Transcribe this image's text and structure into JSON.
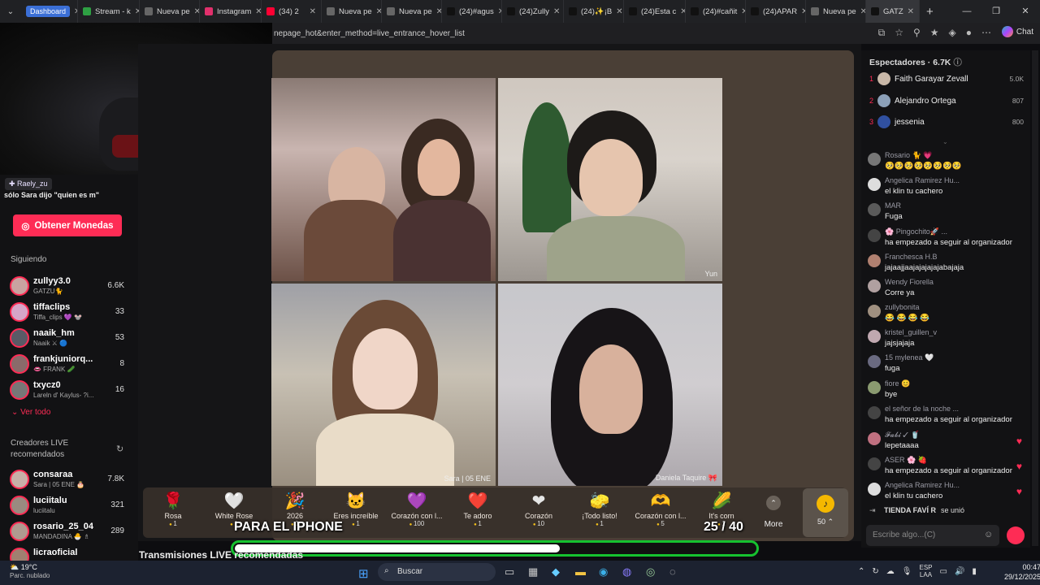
{
  "browser": {
    "tabs": [
      {
        "label": "Dashboard",
        "color": "#3b6fd6"
      },
      {
        "label": "Stream - k",
        "color": "#2ea043"
      },
      {
        "label": "Nueva pe",
        "color": "#666"
      },
      {
        "label": "Instagram",
        "color": "#e1306c"
      },
      {
        "label": "(34) 2",
        "color": "#ff0033"
      },
      {
        "label": "Nueva pe",
        "color": "#666"
      },
      {
        "label": "Nueva pe",
        "color": "#666"
      },
      {
        "label": "(24)#agus",
        "color": "#111"
      },
      {
        "label": "(24)Zully",
        "color": "#111"
      },
      {
        "label": "(24)✨¡B",
        "color": "#111"
      },
      {
        "label": "(24)Esta c",
        "color": "#111"
      },
      {
        "label": "(24)#cañit",
        "color": "#111"
      },
      {
        "label": "(24)APAR",
        "color": "#111"
      },
      {
        "label": "Nueva pe",
        "color": "#666"
      },
      {
        "label": "GATZ",
        "color": "#111"
      }
    ],
    "new_tab": "+",
    "address": "nepage_hot&enter_method=live_entrance_hover_list",
    "chat_label": "Chat"
  },
  "overlay": {
    "chat_user": "Raely_zu",
    "chat_message": "sólo Sara dijo \"quien es m\"",
    "iphone_text": "PARA EL IPHONE",
    "goal_count": "25 / 40",
    "goal_progress": 0.625
  },
  "sidebar": {
    "coins_button": "Obtener Monedas",
    "following_title": "Siguiendo",
    "following": [
      {
        "name": "zullyy3.0",
        "sub": "GATZU🐈",
        "count": "6.6K"
      },
      {
        "name": "tiffaclips",
        "sub": "Tiffa_clips 💜 🐭",
        "count": "33"
      },
      {
        "name": "naaik_hm",
        "sub": "Naaik ⚔ 🔵",
        "count": "53"
      },
      {
        "name": "frankjuniorq...",
        "sub": "👄 FRANK 🥒",
        "count": "8"
      },
      {
        "name": "txycz0",
        "sub": "Lareln d' Kaylus- ?i...",
        "count": "16"
      }
    ],
    "see_all": "Ver todo",
    "creators_title": "Creadores LIVE recomendados",
    "creators": [
      {
        "name": "consaraa",
        "sub": "Sara | 05 ENE 🎂",
        "count": "7.8K"
      },
      {
        "name": "luciitalu",
        "sub": "luciitalu",
        "count": "321"
      },
      {
        "name": "rosario_25_04",
        "sub": "MANDADINA 🐣 ♗",
        "count": "289"
      },
      {
        "name": "licraoficial",
        "sub": "",
        "count": ""
      }
    ]
  },
  "stage": {
    "tile_labels": [
      "",
      "Yun",
      "Sara | 05 ENE",
      "Daniela Taquire 🎀"
    ],
    "recommended_title": "Transmisiones LIVE recomendadas"
  },
  "gifts": [
    {
      "name": "Rosa",
      "price": "1",
      "icon": "🌹"
    },
    {
      "name": "White Rose",
      "price": "1",
      "icon": "🤍"
    },
    {
      "name": "2026",
      "price": "1",
      "icon": "🎉"
    },
    {
      "name": "Eres increíble",
      "price": "1",
      "icon": "🐱"
    },
    {
      "name": "Corazón con l...",
      "price": "100",
      "icon": "💜"
    },
    {
      "name": "Te adoro",
      "price": "1",
      "icon": "❤️"
    },
    {
      "name": "Corazón",
      "price": "10",
      "icon": "❤"
    },
    {
      "name": "¡Todo listo!",
      "price": "1",
      "icon": "🧽"
    },
    {
      "name": "Corazón con l...",
      "price": "5",
      "icon": "🫶"
    },
    {
      "name": "It's corn",
      "price": "1",
      "icon": "🌽"
    }
  ],
  "gift_more": "More",
  "coin_balance": "50",
  "viewers": {
    "title": "Espectadores · 6.7K",
    "top": [
      {
        "rank": "1",
        "name": "Faith Garayar Zevall",
        "score": "5.0K"
      },
      {
        "rank": "2",
        "name": "Alejandro Ortega",
        "score": "807"
      },
      {
        "rank": "3",
        "name": "jessenia",
        "score": "800"
      }
    ]
  },
  "chat": {
    "messages": [
      {
        "user": "Rosario 🐈 💗",
        "text": "🥺🥺🥺🥺🥺🥺🥺🥺"
      },
      {
        "user": "Angelica Ramirez Hu...",
        "text": "el klin tu cachero"
      },
      {
        "user": "MAR",
        "text": "Fuga"
      },
      {
        "user": "🌸 Pingochito🚀 ...",
        "text": "ha empezado a seguir al organizador"
      },
      {
        "user": "Franchesca H.B",
        "text": "jajaajjaajajajajajabajaja"
      },
      {
        "user": "Wendy Fiorella",
        "text": "Corre ya"
      },
      {
        "user": "zullybonita",
        "text": "😂 😂 😂 😂"
      },
      {
        "user": "kristel_guillen_v",
        "text": "jajsjajaja"
      },
      {
        "user": "15 mylenea 🤍",
        "text": "fuga"
      },
      {
        "user": "fiore 😊",
        "text": "bye"
      },
      {
        "user": "el señor de la noche ...",
        "text": "ha empezado a seguir al organizador"
      },
      {
        "user": "𝓕𝓪𝓫𝓲 ✓ 🥤",
        "text": "lepetaaaa"
      },
      {
        "user": "ASER 🌸 🍓",
        "text": "ha empezado a seguir al organizador"
      },
      {
        "user": "Angelica Ramirez Hu...",
        "text": "el klin tu cachero"
      }
    ],
    "joined_user": "TIENDA FAVÍ R",
    "joined_text": "se unió",
    "input_placeholder": "Escribe algo...(C)"
  },
  "taskbar": {
    "temp": "19°C",
    "weather": "Parc. nublado",
    "search_placeholder": "Buscar",
    "lang": "ESP",
    "lang2": "LAA",
    "time": "00:47",
    "date": "29/12/2025"
  },
  "colors": {
    "accent": "#fe2c55",
    "goal_border": "#16c22f",
    "coin": "#f5c21a"
  }
}
